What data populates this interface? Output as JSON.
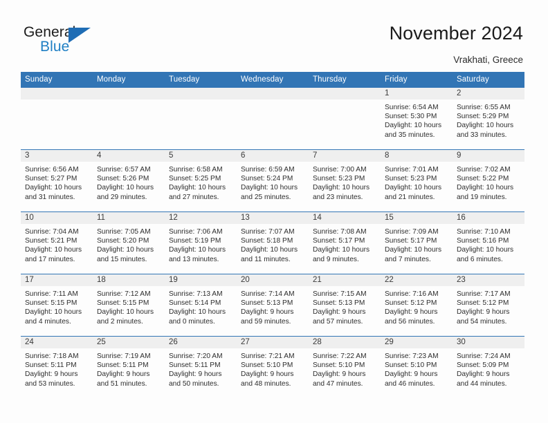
{
  "brand": {
    "name_part1": "General",
    "name_part2": "Blue",
    "triangle_color": "#1f6db5",
    "blue_color": "#1f7fc4"
  },
  "header": {
    "title": "November 2024",
    "location": "Vrakhati, Greece"
  },
  "theme": {
    "header_blue": "#3275b5",
    "daynum_gray": "#efefef",
    "text_color": "#2d2d2d",
    "page_background": "#fdfdfd"
  },
  "calendar": {
    "weekdays": [
      "Sunday",
      "Monday",
      "Tuesday",
      "Wednesday",
      "Thursday",
      "Friday",
      "Saturday"
    ],
    "weeks": [
      [
        {
          "day": "",
          "info": "",
          "empty": true
        },
        {
          "day": "",
          "info": "",
          "empty": true
        },
        {
          "day": "",
          "info": "",
          "empty": true
        },
        {
          "day": "",
          "info": "",
          "empty": true
        },
        {
          "day": "",
          "info": "",
          "empty": true
        },
        {
          "day": "1",
          "info": "Sunrise: 6:54 AM\nSunset: 5:30 PM\nDaylight: 10 hours and 35 minutes.",
          "empty": false
        },
        {
          "day": "2",
          "info": "Sunrise: 6:55 AM\nSunset: 5:29 PM\nDaylight: 10 hours and 33 minutes.",
          "empty": false
        }
      ],
      [
        {
          "day": "3",
          "info": "Sunrise: 6:56 AM\nSunset: 5:27 PM\nDaylight: 10 hours and 31 minutes.",
          "empty": false
        },
        {
          "day": "4",
          "info": "Sunrise: 6:57 AM\nSunset: 5:26 PM\nDaylight: 10 hours and 29 minutes.",
          "empty": false
        },
        {
          "day": "5",
          "info": "Sunrise: 6:58 AM\nSunset: 5:25 PM\nDaylight: 10 hours and 27 minutes.",
          "empty": false
        },
        {
          "day": "6",
          "info": "Sunrise: 6:59 AM\nSunset: 5:24 PM\nDaylight: 10 hours and 25 minutes.",
          "empty": false
        },
        {
          "day": "7",
          "info": "Sunrise: 7:00 AM\nSunset: 5:23 PM\nDaylight: 10 hours and 23 minutes.",
          "empty": false
        },
        {
          "day": "8",
          "info": "Sunrise: 7:01 AM\nSunset: 5:23 PM\nDaylight: 10 hours and 21 minutes.",
          "empty": false
        },
        {
          "day": "9",
          "info": "Sunrise: 7:02 AM\nSunset: 5:22 PM\nDaylight: 10 hours and 19 minutes.",
          "empty": false
        }
      ],
      [
        {
          "day": "10",
          "info": "Sunrise: 7:04 AM\nSunset: 5:21 PM\nDaylight: 10 hours and 17 minutes.",
          "empty": false
        },
        {
          "day": "11",
          "info": "Sunrise: 7:05 AM\nSunset: 5:20 PM\nDaylight: 10 hours and 15 minutes.",
          "empty": false
        },
        {
          "day": "12",
          "info": "Sunrise: 7:06 AM\nSunset: 5:19 PM\nDaylight: 10 hours and 13 minutes.",
          "empty": false
        },
        {
          "day": "13",
          "info": "Sunrise: 7:07 AM\nSunset: 5:18 PM\nDaylight: 10 hours and 11 minutes.",
          "empty": false
        },
        {
          "day": "14",
          "info": "Sunrise: 7:08 AM\nSunset: 5:17 PM\nDaylight: 10 hours and 9 minutes.",
          "empty": false
        },
        {
          "day": "15",
          "info": "Sunrise: 7:09 AM\nSunset: 5:17 PM\nDaylight: 10 hours and 7 minutes.",
          "empty": false
        },
        {
          "day": "16",
          "info": "Sunrise: 7:10 AM\nSunset: 5:16 PM\nDaylight: 10 hours and 6 minutes.",
          "empty": false
        }
      ],
      [
        {
          "day": "17",
          "info": "Sunrise: 7:11 AM\nSunset: 5:15 PM\nDaylight: 10 hours and 4 minutes.",
          "empty": false
        },
        {
          "day": "18",
          "info": "Sunrise: 7:12 AM\nSunset: 5:15 PM\nDaylight: 10 hours and 2 minutes.",
          "empty": false
        },
        {
          "day": "19",
          "info": "Sunrise: 7:13 AM\nSunset: 5:14 PM\nDaylight: 10 hours and 0 minutes.",
          "empty": false
        },
        {
          "day": "20",
          "info": "Sunrise: 7:14 AM\nSunset: 5:13 PM\nDaylight: 9 hours and 59 minutes.",
          "empty": false
        },
        {
          "day": "21",
          "info": "Sunrise: 7:15 AM\nSunset: 5:13 PM\nDaylight: 9 hours and 57 minutes.",
          "empty": false
        },
        {
          "day": "22",
          "info": "Sunrise: 7:16 AM\nSunset: 5:12 PM\nDaylight: 9 hours and 56 minutes.",
          "empty": false
        },
        {
          "day": "23",
          "info": "Sunrise: 7:17 AM\nSunset: 5:12 PM\nDaylight: 9 hours and 54 minutes.",
          "empty": false
        }
      ],
      [
        {
          "day": "24",
          "info": "Sunrise: 7:18 AM\nSunset: 5:11 PM\nDaylight: 9 hours and 53 minutes.",
          "empty": false
        },
        {
          "day": "25",
          "info": "Sunrise: 7:19 AM\nSunset: 5:11 PM\nDaylight: 9 hours and 51 minutes.",
          "empty": false
        },
        {
          "day": "26",
          "info": "Sunrise: 7:20 AM\nSunset: 5:11 PM\nDaylight: 9 hours and 50 minutes.",
          "empty": false
        },
        {
          "day": "27",
          "info": "Sunrise: 7:21 AM\nSunset: 5:10 PM\nDaylight: 9 hours and 48 minutes.",
          "empty": false
        },
        {
          "day": "28",
          "info": "Sunrise: 7:22 AM\nSunset: 5:10 PM\nDaylight: 9 hours and 47 minutes.",
          "empty": false
        },
        {
          "day": "29",
          "info": "Sunrise: 7:23 AM\nSunset: 5:10 PM\nDaylight: 9 hours and 46 minutes.",
          "empty": false
        },
        {
          "day": "30",
          "info": "Sunrise: 7:24 AM\nSunset: 5:09 PM\nDaylight: 9 hours and 44 minutes.",
          "empty": false
        }
      ]
    ]
  }
}
